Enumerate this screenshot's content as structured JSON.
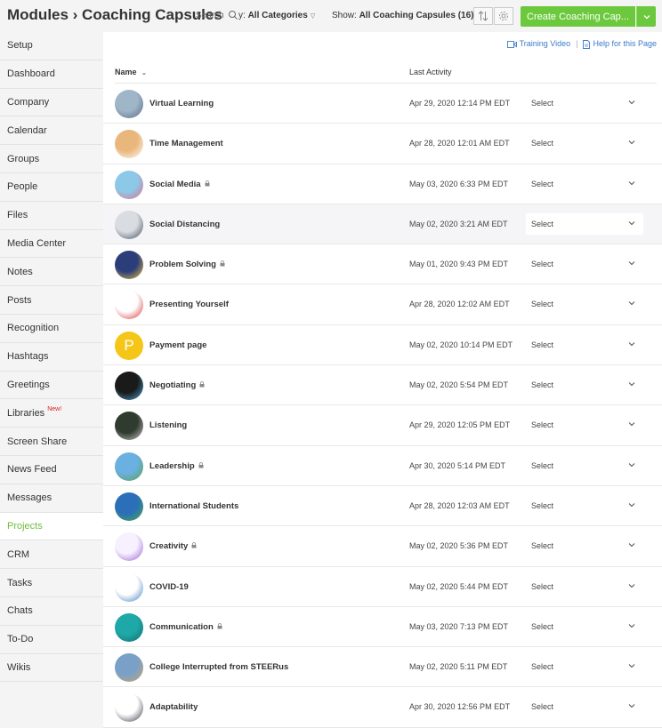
{
  "header": {
    "title": "Modules › Coaching Capsules",
    "search_label": "Search",
    "category_prefix": "y: ",
    "category_value": "All Categories",
    "show_prefix": "Show: ",
    "show_value": "All Coaching Capsules (16)",
    "create_label": "Create Coaching Cap..."
  },
  "colors": {
    "accent": "#6cc93d",
    "link": "#3a7bc8",
    "new_badge": "#e02020"
  },
  "help": {
    "training_video": "Training Video",
    "help_page": "Help for this Page"
  },
  "table": {
    "col_name": "Name",
    "col_activity": "Last Activity"
  },
  "sidebar": {
    "items": [
      {
        "label": "Setup"
      },
      {
        "label": "Dashboard"
      },
      {
        "label": "Company"
      },
      {
        "label": "Calendar"
      },
      {
        "label": "Groups"
      },
      {
        "label": "People"
      },
      {
        "label": "Files"
      },
      {
        "label": "Media Center"
      },
      {
        "label": "Notes"
      },
      {
        "label": "Posts"
      },
      {
        "label": "Recognition"
      },
      {
        "label": "Hashtags"
      },
      {
        "label": "Greetings"
      },
      {
        "label": "Libraries",
        "badge": "New!"
      },
      {
        "label": "Screen Share"
      },
      {
        "label": "News Feed"
      },
      {
        "label": "Messages"
      },
      {
        "label": "Projects",
        "active": true
      },
      {
        "label": "CRM"
      },
      {
        "label": "Tasks"
      },
      {
        "label": "Chats"
      },
      {
        "label": "To-Do"
      },
      {
        "label": "Wikis"
      }
    ]
  },
  "rows": [
    {
      "name": "Virtual Learning",
      "date": "Apr 29, 2020 12:14 PM EDT",
      "action": "Select",
      "locked": false,
      "icon": "laptop-desk-thumbnail"
    },
    {
      "name": "Time Management",
      "date": "Apr 28, 2020 12:01 AM EDT",
      "action": "Select",
      "locked": false,
      "icon": "clock-thumbnail"
    },
    {
      "name": "Social Media",
      "date": "May 03, 2020 6:33 PM EDT",
      "action": "Select",
      "locked": true,
      "icon": "social-people-thumbnail"
    },
    {
      "name": "Social Distancing",
      "date": "May 02, 2020 3:21 AM EDT",
      "action": "Select",
      "locked": false,
      "icon": "desk-thumbnail",
      "highlighted": true
    },
    {
      "name": "Problem Solving",
      "date": "May 01, 2020 9:43 PM EDT",
      "action": "Select",
      "locked": true,
      "icon": "puzzle-thumbnail"
    },
    {
      "name": "Presenting Yourself",
      "date": "Apr 28, 2020 12:02 AM EDT",
      "action": "Select",
      "locked": false,
      "icon": "presenter-thumbnail"
    },
    {
      "name": "Payment page",
      "date": "May 02, 2020 10:14 PM EDT",
      "action": "Select",
      "locked": false,
      "icon": "letter-p-avatar",
      "avatar_letter": "P"
    },
    {
      "name": "Negotiating",
      "date": "May 02, 2020 5:54 PM EDT",
      "action": "Select",
      "locked": true,
      "icon": "handshake-thumbnail"
    },
    {
      "name": "Listening",
      "date": "Apr 29, 2020 12:05 PM EDT",
      "action": "Select",
      "locked": false,
      "icon": "ear-thumbnail"
    },
    {
      "name": "Leadership",
      "date": "Apr 30, 2020 5:14 PM EDT",
      "action": "Select",
      "locked": true,
      "icon": "mountain-flag-thumbnail"
    },
    {
      "name": "International Students",
      "date": "Apr 28, 2020 12:03 AM EDT",
      "action": "Select",
      "locked": false,
      "icon": "globe-thumbnail"
    },
    {
      "name": "Creativity",
      "date": "May 02, 2020 5:36 PM EDT",
      "action": "Select",
      "locked": true,
      "icon": "lightbulb-thumbnail"
    },
    {
      "name": "COVID-19",
      "date": "May 02, 2020 5:44 PM EDT",
      "action": "Select",
      "locked": false,
      "icon": "masked-people-thumbnail"
    },
    {
      "name": "Communication",
      "date": "May 03, 2020 7:13 PM EDT",
      "action": "Select",
      "locked": true,
      "icon": "speech-people-thumbnail"
    },
    {
      "name": "College Interrupted from STEERus",
      "date": "May 02, 2020 5:11 PM EDT",
      "action": "Select",
      "locked": false,
      "icon": "college-building-thumbnail"
    },
    {
      "name": "Adaptability",
      "date": "Apr 30, 2020 12:56 PM EDT",
      "action": "Select",
      "locked": false,
      "icon": "acrobat-thumbnail"
    }
  ]
}
